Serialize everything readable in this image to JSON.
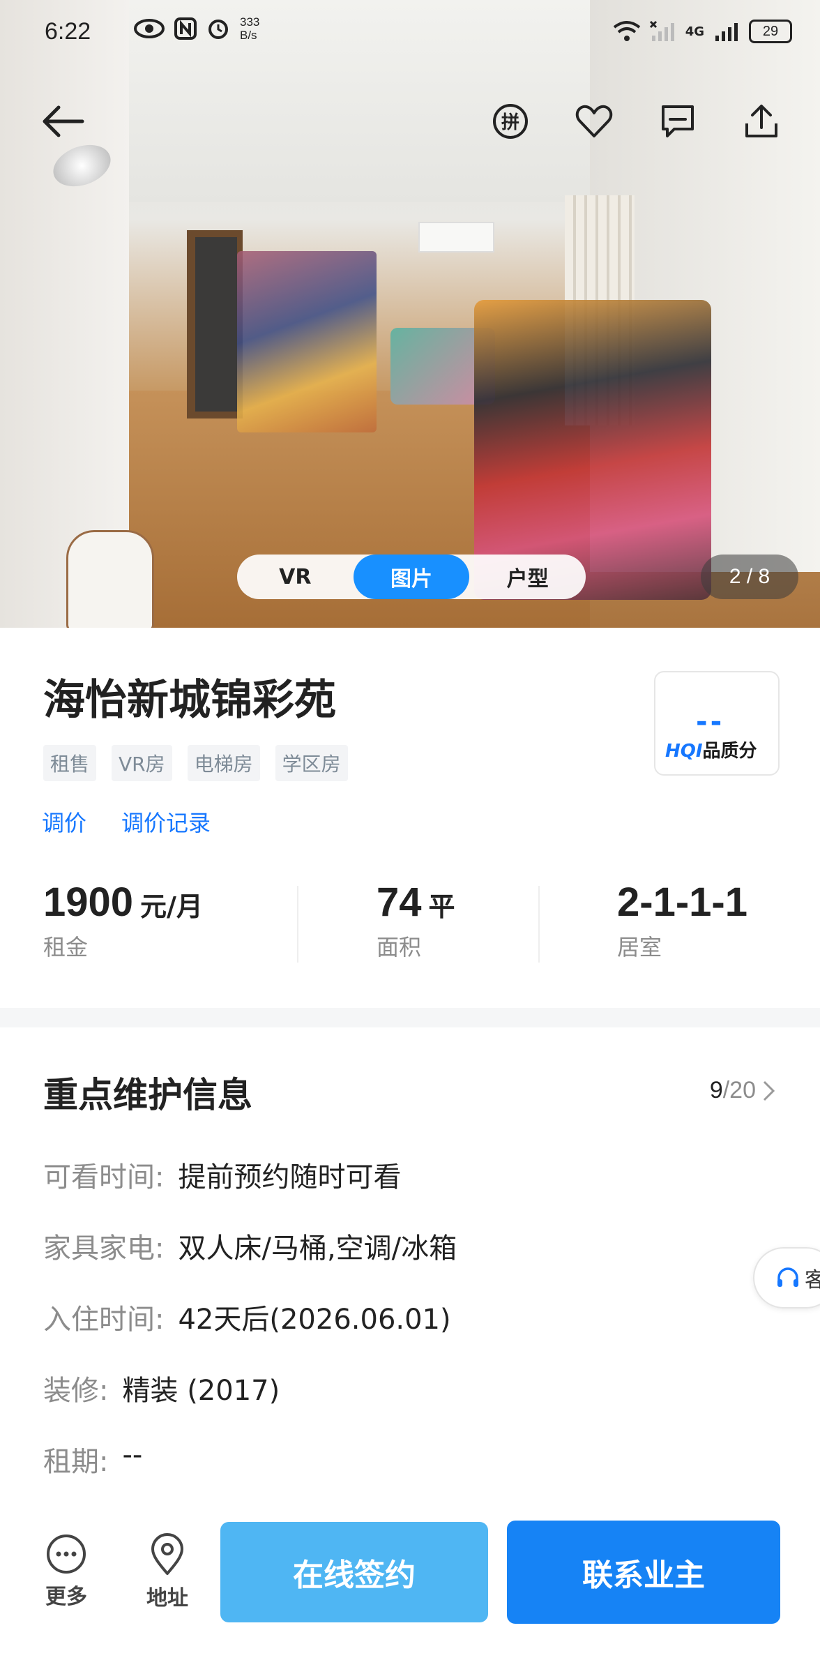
{
  "status_bar": {
    "time": "6:22",
    "net_speed_value": "333",
    "net_speed_unit": "B/s",
    "network": "4G",
    "battery": "29"
  },
  "media": {
    "tabs": [
      {
        "label": "VR",
        "active": false
      },
      {
        "label": "图片",
        "active": true
      },
      {
        "label": "户型",
        "active": false
      }
    ],
    "counter": "2 / 8"
  },
  "listing": {
    "title": "海怡新城锦彩苑",
    "tags": [
      "租售",
      "VR房",
      "电梯房",
      "学区房"
    ],
    "links": [
      "调价",
      "调价记录"
    ],
    "hqi": {
      "score": "--",
      "brand": "HQI",
      "label": "品质分"
    }
  },
  "stats": [
    {
      "value": "1900",
      "unit": "元/月",
      "label": "租金"
    },
    {
      "value": "74",
      "unit": "平",
      "label": "面积"
    },
    {
      "value": "2-1-1-1",
      "unit": "",
      "label": "居室"
    }
  ],
  "key_info": {
    "title": "重点维护信息",
    "progress_current": "9",
    "progress_total": "/20",
    "rows": [
      {
        "label": "可看时间:",
        "value": "提前预约随时可看"
      },
      {
        "label": "家具家电:",
        "value": "双人床/马桶,空调/冰箱"
      },
      {
        "label": "入住时间:",
        "value": "42天后(2026.06.01)"
      },
      {
        "label": "装修:",
        "value": "精装 (2017)"
      },
      {
        "label": "租期:",
        "value": "--"
      }
    ]
  },
  "floating_support": {
    "label": "客"
  },
  "bottom_bar": {
    "more_label": "更多",
    "address_label": "地址",
    "sign_label": "在线签约",
    "contact_label": "联系业主"
  },
  "colors": {
    "accent": "#1677ff",
    "sign_button": "#4fb6f3",
    "contact_button": "#1683f5"
  }
}
